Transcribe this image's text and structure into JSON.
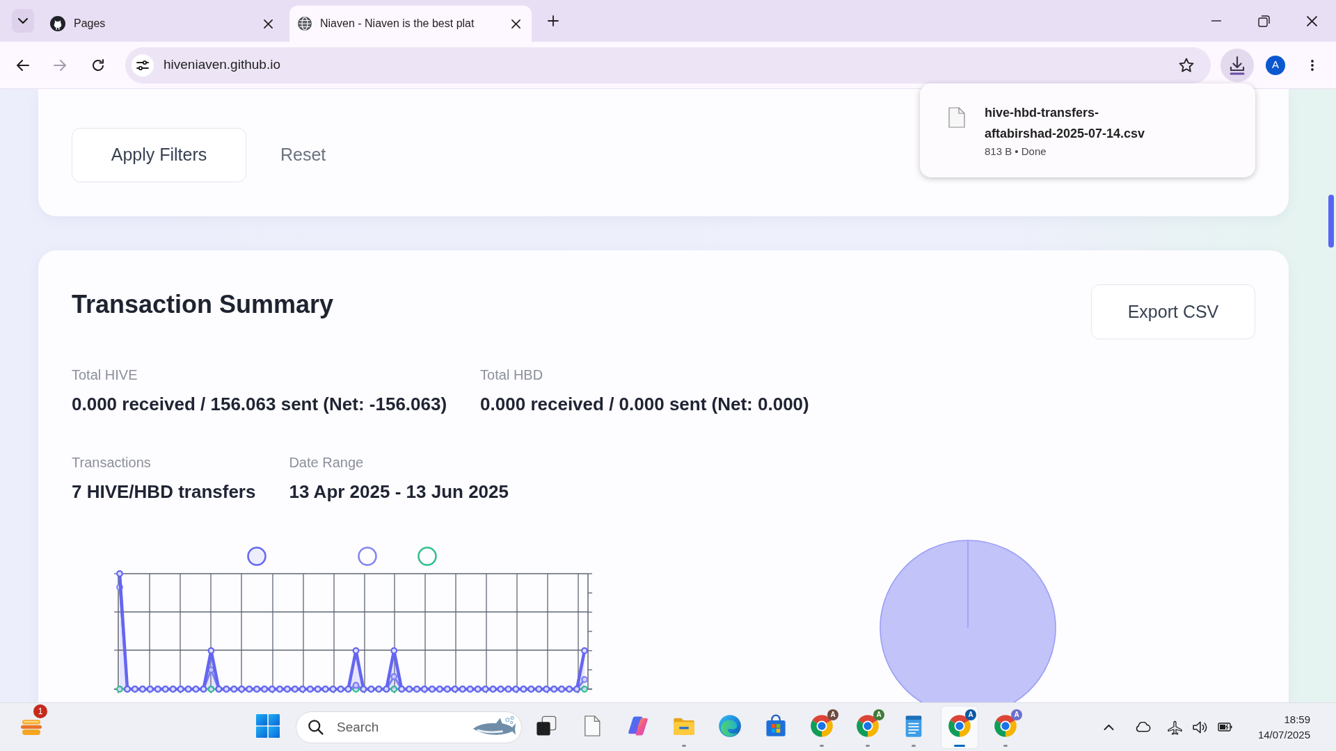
{
  "browser": {
    "tabs": [
      {
        "kind": "cat",
        "title": "Pages",
        "selected": false
      },
      {
        "kind": "globe",
        "title": "Niaven - Niaven is the best plat",
        "selected": true
      }
    ],
    "nav_buttons": [
      {
        "kind": "back",
        "disabled": false
      },
      {
        "kind": "forward",
        "disabled": true
      },
      {
        "kind": "reload",
        "disabled": false
      }
    ],
    "address": "hiveniaven.github.io",
    "profile_initial": "A"
  },
  "download_popup": {
    "file_name": "hive-hbd-transfers-aftabirshad-2025-07-14.csv",
    "status": "813 B • Done"
  },
  "filters": {
    "buttons": [
      {
        "kind": "outline",
        "label": "Apply Filters"
      },
      {
        "kind": "text",
        "label": "Reset"
      }
    ]
  },
  "summary": {
    "title": "Transaction Summary",
    "export_button": "Export CSV",
    "stat_rows": [
      [
        {
          "label": "Total HIVE",
          "value": "0.000 received / 156.063 sent (Net: -156.063)"
        },
        {
          "label": "Total HBD",
          "value": "0.000 received / 0.000 sent (Net: 0.000)"
        }
      ],
      [
        {
          "label": "Transactions",
          "value": "7 HIVE/HBD transfers"
        },
        {
          "label": "Date Range",
          "value": "13 Apr 2025 - 13 Jun 2025"
        }
      ]
    ],
    "series": [
      {
        "kind": "area",
        "color": "#6466f1"
      },
      {
        "kind": "line",
        "color": "#8184f2"
      },
      {
        "kind": "line",
        "color": "#2fbf8b"
      }
    ]
  },
  "taskbar": {
    "widget_badge": "1",
    "search": {
      "placeholder": "Search"
    },
    "apps": [
      {
        "kind": "task-view",
        "running": false,
        "selected": false
      },
      {
        "kind": "document",
        "running": false,
        "selected": false
      },
      {
        "kind": "copilot",
        "running": false,
        "selected": false
      },
      {
        "kind": "folder",
        "running": true,
        "selected": false
      },
      {
        "kind": "edge",
        "running": false,
        "selected": false
      },
      {
        "kind": "store",
        "running": false,
        "selected": false
      },
      {
        "kind": "chrome",
        "badge": "A",
        "color": "#6d4c41",
        "running": true,
        "selected": false
      },
      {
        "kind": "chrome",
        "badge": "A",
        "color": "#3f7b36",
        "running": true,
        "selected": false
      },
      {
        "kind": "notepad",
        "running": true,
        "selected": false
      },
      {
        "kind": "chrome",
        "badge": "A",
        "color": "#0b57a4",
        "running": true,
        "selected": true
      },
      {
        "kind": "chrome",
        "badge": "A",
        "color": "#6c70cc",
        "running": true,
        "selected": false
      }
    ],
    "clock": {
      "time": "18:59",
      "date": "14/07/2025"
    }
  }
}
